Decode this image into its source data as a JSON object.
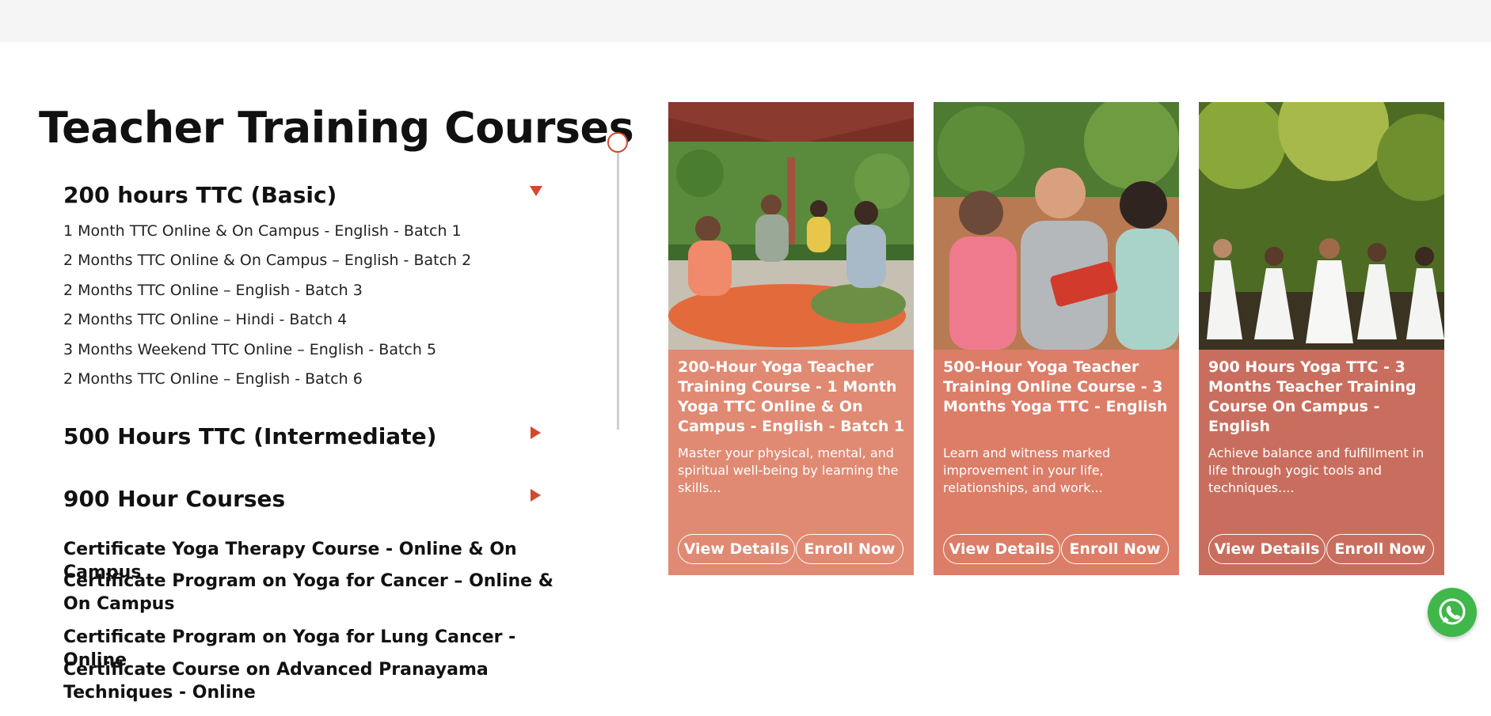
{
  "title": "Teacher Training Courses",
  "accordion": {
    "sections": [
      {
        "heading": "200 hours TTC (Basic)",
        "expanded": true,
        "items": [
          "1 Month TTC Online & On Campus - English - Batch 1",
          "2 Months TTC Online & On Campus – English - Batch 2",
          "2 Months TTC Online – English - Batch 3",
          "2 Months TTC Online – Hindi - Batch 4",
          "3 Months Weekend TTC Online – English - Batch 5",
          "2 Months TTC Online – English - Batch 6"
        ]
      },
      {
        "heading": "500 Hours TTC (Intermediate)",
        "expanded": false
      },
      {
        "heading": "900 Hour Courses",
        "expanded": false
      }
    ],
    "arrow_color": "#d24a2d"
  },
  "certificates": [
    "Certificate Yoga Therapy Course - Online & On Campus",
    "Certificate Program on Yoga for Cancer – Online & On Campus",
    "Certificate Program on Yoga for Lung Cancer - Online",
    "Certificate Course on Advanced Pranayama Techniques - Online"
  ],
  "cards": [
    {
      "title": "200-Hour Yoga Teacher Training Course - 1 Month Yoga TTC Online & On Campus - English - Batch 1",
      "description": "Master your physical, mental, and spiritual well-being by learning the skills...",
      "view_label": "View Details",
      "enroll_label": "Enroll Now",
      "color": "#e08a73",
      "image": "group-yoga-class-under-gazebo"
    },
    {
      "title": "500-Hour Yoga Teacher Training Online Course - 3 Months Yoga TTC - English",
      "description": "Learn and witness marked improvement in your life, relationships, and work...",
      "view_label": "View Details",
      "enroll_label": "Enroll Now",
      "color": "#dc7d68",
      "image": "three-people-reading-book"
    },
    {
      "title": "900 Hours Yoga TTC - 3 Months Teacher Training Course On Campus - English",
      "description": "Achieve balance and fulfillment in life through yogic tools and techniques....",
      "view_label": "View Details",
      "enroll_label": "Enroll Now",
      "color": "#c96e5e",
      "image": "group-meditating-in-forest"
    }
  ],
  "colors": {
    "accent": "#d24a2d",
    "whatsapp": "#3fb74a",
    "topbar": "#f5f5f5"
  },
  "floating": {
    "icon": "whatsapp-icon"
  }
}
